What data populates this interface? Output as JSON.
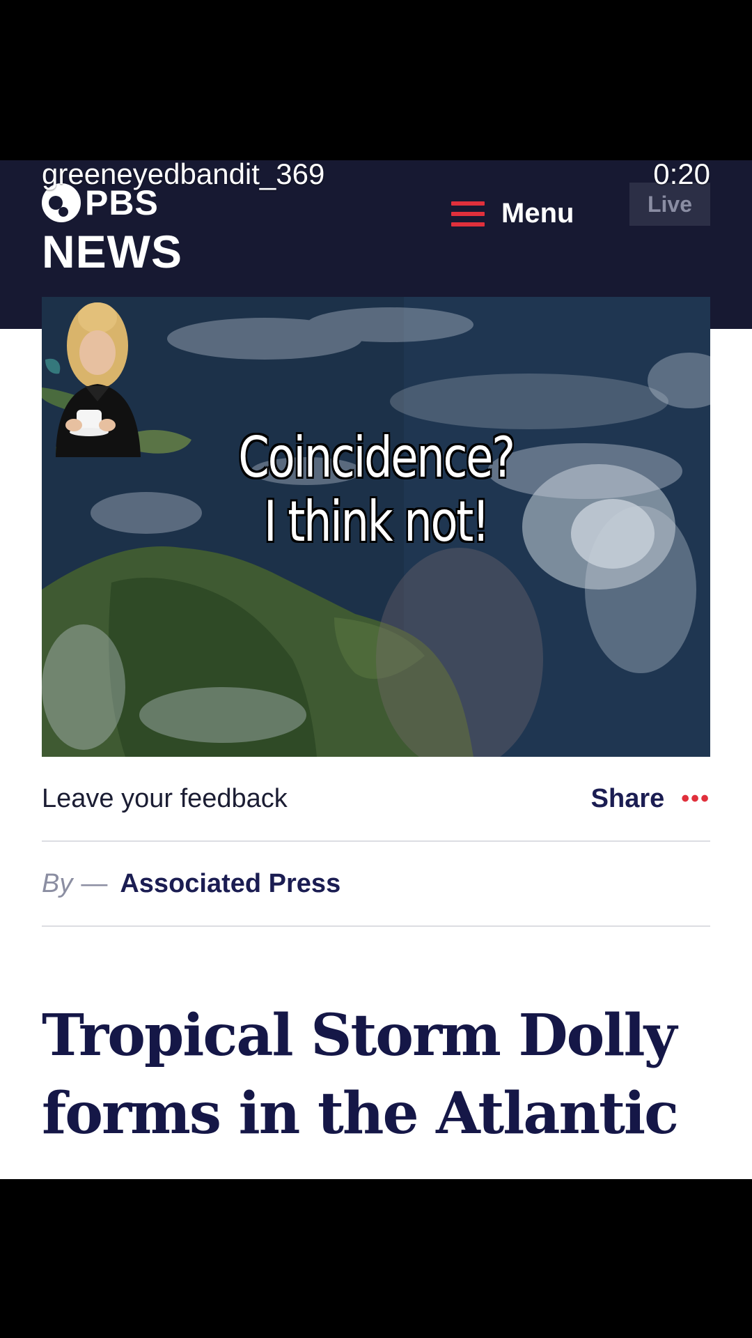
{
  "overlay": {
    "username": "greeneyedbandit_369",
    "timestamp": "0:20"
  },
  "header": {
    "logo_top": "PBS",
    "logo_bottom": "NEWS",
    "menu_label": "Menu",
    "live_label": "Live"
  },
  "hero": {
    "caption_line1": "Coincidence?",
    "caption_line2": "I think not!"
  },
  "article": {
    "feedback_label": "Leave your feedback",
    "share_label": "Share",
    "more_label": "•••",
    "by_label": "By",
    "by_dash": "—",
    "author": "Associated Press",
    "headline": "Tropical Storm Dolly forms in the Atlantic"
  },
  "colors": {
    "header_bg": "#171932",
    "accent_red": "#e0303c",
    "headline_navy": "#151747"
  }
}
